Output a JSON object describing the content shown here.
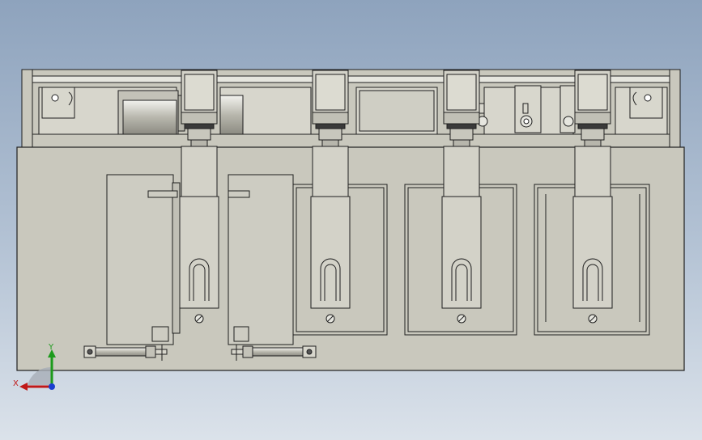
{
  "viewport": {
    "background_top": "#8ea3bd",
    "background_bottom": "#dbe2ea"
  },
  "model": {
    "body_fill": "#c9c8bd",
    "line_color": "#1f1f1f",
    "dark_part": "#3a3a3a",
    "highlight": "#e6e6df",
    "gripper_count": 4,
    "side_clamp_count": 2,
    "roller_count": 2
  },
  "triad": {
    "x_label": "X",
    "y_label": "Y",
    "x_color": "#c01818",
    "y_color": "#1c9a1c",
    "z_color": "#1a3fd0"
  }
}
